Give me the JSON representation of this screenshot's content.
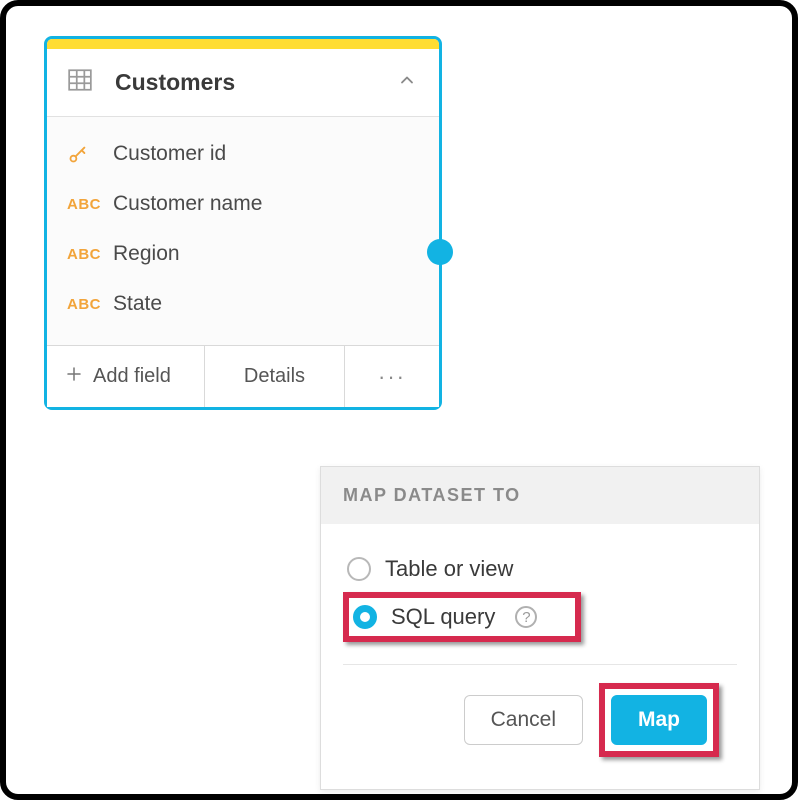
{
  "card": {
    "title": "Customers",
    "fields": [
      {
        "type_label": "",
        "label": "Customer id"
      },
      {
        "type_label": "ABC",
        "label": "Customer name"
      },
      {
        "type_label": "ABC",
        "label": "Region"
      },
      {
        "type_label": "ABC",
        "label": "State"
      }
    ],
    "footer": {
      "add_label": "Add field",
      "details_label": "Details"
    }
  },
  "popover": {
    "title": "MAP DATASET TO",
    "options": {
      "table_view": "Table or view",
      "sql_query": "SQL query"
    },
    "help_glyph": "?",
    "buttons": {
      "cancel": "Cancel",
      "map": "Map"
    }
  }
}
